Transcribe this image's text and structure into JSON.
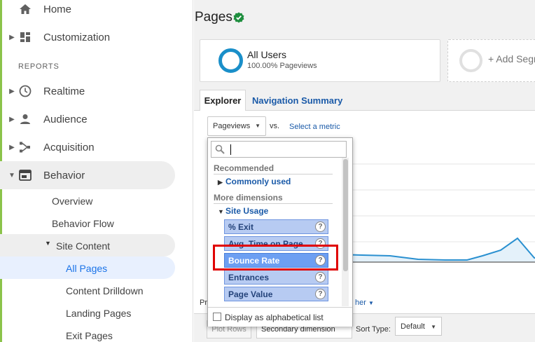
{
  "sidebar": {
    "items": [
      {
        "label": "Home",
        "icon": "home-icon"
      },
      {
        "label": "Customization",
        "icon": "dashboard-icon"
      },
      {
        "label": "Realtime",
        "icon": "clock-icon"
      },
      {
        "label": "Audience",
        "icon": "person-icon"
      },
      {
        "label": "Acquisition",
        "icon": "acquisition-icon"
      },
      {
        "label": "Behavior",
        "icon": "behavior-icon"
      }
    ],
    "section_label": "REPORTS",
    "behavior_children": [
      "Overview",
      "Behavior Flow",
      "Site Content"
    ],
    "site_content_children": [
      "All Pages",
      "Content Drilldown",
      "Landing Pages",
      "Exit Pages"
    ]
  },
  "main": {
    "title": "Pages",
    "segment": {
      "name": "All Users",
      "sub": "100.00% Pageviews"
    },
    "add_segment": "+ Add Segm",
    "tabs": [
      "Explorer",
      "Navigation Summary"
    ],
    "metric_select": "Pageviews",
    "vs": "vs.",
    "select_metric": "Select a metric",
    "bottom": {
      "plot_rows": "Plot Rows",
      "secondary_dimension": "Secondary dimension",
      "sort_label": "Sort Type:",
      "sort_value": "Default",
      "left_fragment": "Pr",
      "right_fragment": "her"
    }
  },
  "dropdown": {
    "search_value": "",
    "recommended": "Recommended",
    "commonly_used": "Commonly used",
    "more_dimensions": "More dimensions",
    "site_usage": "Site Usage",
    "items": [
      "% Exit",
      "Avg. Time on Page",
      "Bounce Rate",
      "Entrances",
      "Page Value"
    ],
    "help_glyph": "?",
    "alphabetical": "Display as alphabetical list"
  },
  "colors": {
    "accent": "#1a73e8",
    "segment_ring": "#1a8fc9",
    "highlight": "#6d9ff2",
    "item_bg": "#b7cbf2",
    "red_box": "#e00000",
    "side_green": "#8bc34a",
    "chart_line": "#2a90d0"
  }
}
